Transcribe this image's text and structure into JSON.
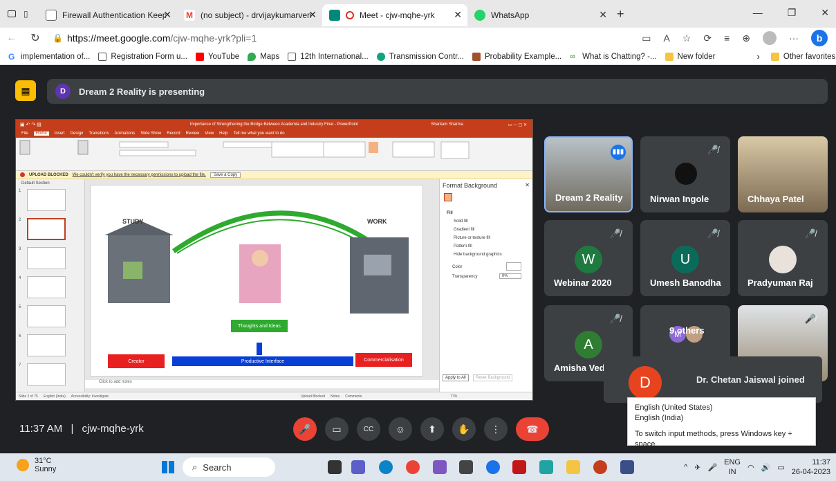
{
  "browser": {
    "tabs": [
      {
        "title": "Firewall Authentication Keepalive",
        "color": "#ffffff",
        "active": false
      },
      {
        "title": "(no subject) - drvijaykumarverma",
        "color": "#ea4335",
        "active": false
      },
      {
        "title": "Meet - cjw-mqhe-yrk",
        "color": "#00897b",
        "active": true
      },
      {
        "title": "WhatsApp",
        "color": "#25d366",
        "active": false
      }
    ],
    "new_tab": "+",
    "url_host": "https://meet.google.com",
    "url_path": "/cjw-mqhe-yrk?pli=1",
    "bookmarks": [
      "implementation of...",
      "Registration Form u...",
      "YouTube",
      "Maps",
      "12th International...",
      "Transmission Contr...",
      "Probability Example...",
      "What is Chatting? -...",
      "New folder"
    ],
    "other_favorites": "Other favorites"
  },
  "meet": {
    "presenting_initial": "D",
    "presenting_text": "Dream 2 Reality is presenting",
    "time": "11:37 AM",
    "separator": "|",
    "meeting_code": "cjw-mqhe-yrk",
    "participants": [
      {
        "name": "Dream 2 Reality",
        "type": "video"
      },
      {
        "name": "Nirwan Ingole",
        "type": "photo"
      },
      {
        "name": "Chhaya Patel",
        "type": "video"
      },
      {
        "name": "Webinar 2020",
        "type": "letter",
        "letter": "W",
        "color": "#1e7a3f"
      },
      {
        "name": "Umesh Banodha",
        "type": "letter",
        "letter": "U",
        "color": "#0b6b5b"
      },
      {
        "name": "Pradyuman Raj",
        "type": "photo"
      },
      {
        "name": "Amisha Ved",
        "type": "letter",
        "letter": "A",
        "color": "#2e7d32"
      },
      {
        "name": "9 others",
        "type": "group",
        "letter": "M"
      },
      {
        "name": "",
        "type": "video"
      }
    ],
    "toast_initial": "D",
    "toast_text": "Dr. Chetan Jaiswal joined"
  },
  "ppt": {
    "title": "Importance of Strengthening the Bridge Between Academia and Industry Final - PowerPoint",
    "user": "Shantam Sharma",
    "tabs": [
      "File",
      "Home",
      "Insert",
      "Design",
      "Transitions",
      "Animations",
      "Slide Show",
      "Record",
      "Review",
      "View",
      "Help",
      "Tell me what you want to do"
    ],
    "blocked_label": "UPLOAD BLOCKED",
    "blocked_msg": "We couldn't verify you have the necessary permissions to upload the file.",
    "blocked_btn": "Save a Copy",
    "section": "Default Section",
    "slide": {
      "study": "STUDY",
      "work": "WORK",
      "thoughts": "Thoughts and Ideas",
      "creator": "Creator",
      "interface": "Productive Interface",
      "commercial": "Commercialisation"
    },
    "notes": "Click to add notes",
    "format_title": "Format Background",
    "fill": "Fill",
    "fill_options": [
      "Solid fill",
      "Gradient fill",
      "Picture or texture fill",
      "Pattern fill",
      "Hide background graphics"
    ],
    "color_label": "Color",
    "transparency_label": "Transparency",
    "transparency_value": "0%",
    "apply_all": "Apply to All",
    "reset": "Reset Background",
    "status": [
      "Slide 2 of 75",
      "English (India)",
      "Accessibility: Investigate",
      "Upload Blocked",
      "Notes",
      "Comments",
      "77%"
    ]
  },
  "tooltip": {
    "lines": [
      "English (United States)",
      "English (India)",
      "",
      "To switch input methods, press Windows key + space."
    ]
  },
  "taskbar": {
    "temp": "31°C",
    "weather": "Sunny",
    "search": "Search",
    "lang1": "ENG",
    "lang2": "IN",
    "clock": "11:37",
    "date": "26-04-2023"
  }
}
